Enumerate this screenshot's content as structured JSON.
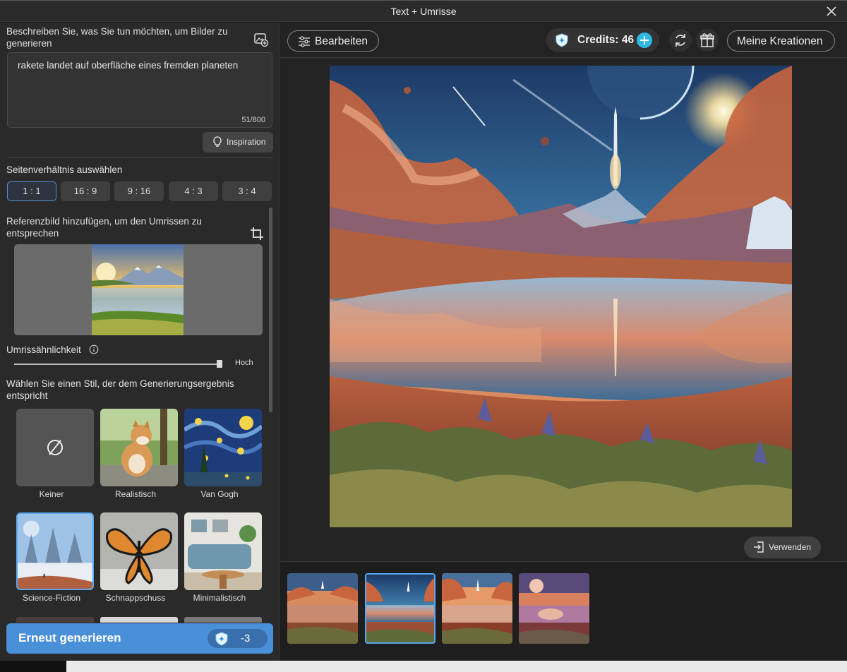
{
  "window": {
    "title": "Text + Umrisse"
  },
  "left": {
    "prompt_label": "Beschreiben Sie, was Sie tun möchten, um Bilder zu generieren",
    "prompt_value": "rakete landet auf oberfläche eines fremden planeten",
    "char_counter": "51/800",
    "inspiration_label": "Inspiration",
    "aspect_label": "Seitenverhältnis auswählen",
    "aspect_ratios": [
      "1 : 1",
      "16 : 9",
      "9 : 16",
      "4 : 3",
      "3 : 4"
    ],
    "aspect_selected": "1 : 1",
    "reference_label": "Referenzbild hinzufügen, um den Umrissen zu entsprechen",
    "similarity_label": "Umrissähnlichkeit",
    "similarity_level": 1.0,
    "similarity_value": "Hoch",
    "style_label": "Wählen Sie einen Stil, der dem Generierungsergebnis entspricht",
    "styles": [
      "Keiner",
      "Realistisch",
      "Van Gogh",
      "Science-Fiction",
      "Schnappschuss",
      "Minimalistisch"
    ],
    "style_selected": "Science-Fiction",
    "regenerate_label": "Erneut generieren",
    "regenerate_cost": "-3"
  },
  "toolbar": {
    "edit_label": "Bearbeiten",
    "credits_label": "Credits: 46",
    "my_creations_label": "Meine Kreationen"
  },
  "preview": {
    "use_label": "Verwenden",
    "thumbnail_count": 4,
    "selected_thumbnail": 2
  },
  "colors": {
    "accent": "#4a90d8",
    "selection": "#5aa6f0",
    "credit_plus": "#2fb7e6"
  }
}
